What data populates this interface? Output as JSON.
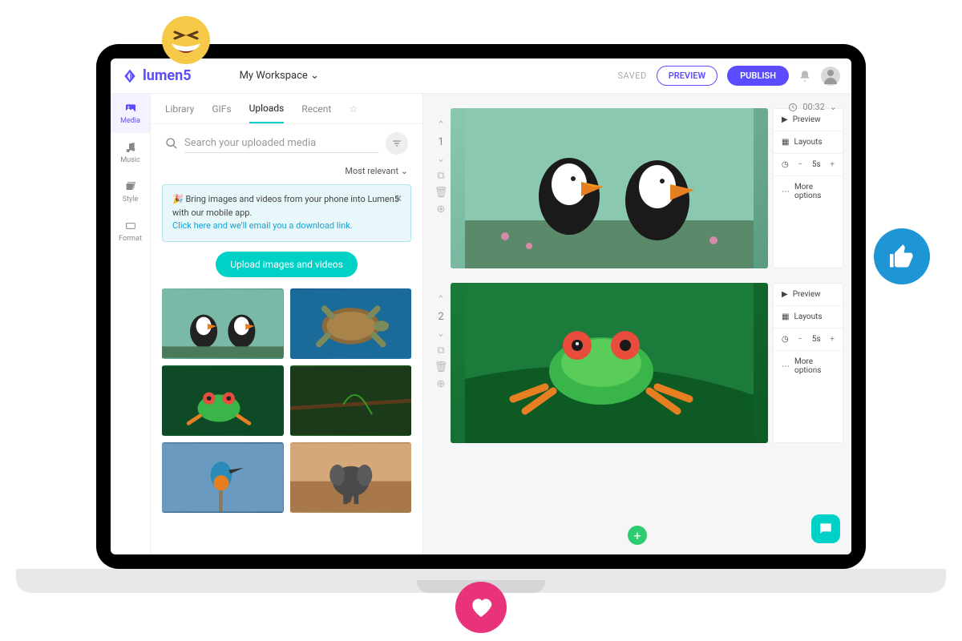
{
  "brand": "lumen5",
  "workspace": "My Workspace",
  "header": {
    "saved": "SAVED",
    "preview": "PREVIEW",
    "publish": "PUBLISH"
  },
  "sidebar": [
    {
      "label": "Media",
      "icon": "image-icon",
      "active": true
    },
    {
      "label": "Music",
      "icon": "note-icon",
      "active": false
    },
    {
      "label": "Style",
      "icon": "palette-icon",
      "active": false
    },
    {
      "label": "Format",
      "icon": "aspect-icon",
      "active": false
    }
  ],
  "tabs": [
    {
      "label": "Library",
      "active": false
    },
    {
      "label": "GIFs",
      "active": false
    },
    {
      "label": "Uploads",
      "active": true
    },
    {
      "label": "Recent",
      "active": false
    }
  ],
  "search": {
    "placeholder": "Search your uploaded media"
  },
  "sort": "Most relevant",
  "banner": {
    "text": "Bring images and videos from your phone into Lumen5 with our mobile app.",
    "link": "Click here and we'll email you a download link."
  },
  "upload_btn": "Upload images and videos",
  "thumbs": [
    "puffins",
    "sea-turtle",
    "tree-frog",
    "green-snake",
    "kingfisher",
    "elephant"
  ],
  "timer": "00:32",
  "scenes": [
    {
      "num": "1",
      "duration": "5s"
    },
    {
      "num": "2",
      "duration": "5s"
    }
  ],
  "scene_opts": {
    "preview": "Preview",
    "layouts": "Layouts",
    "more": "More options"
  }
}
